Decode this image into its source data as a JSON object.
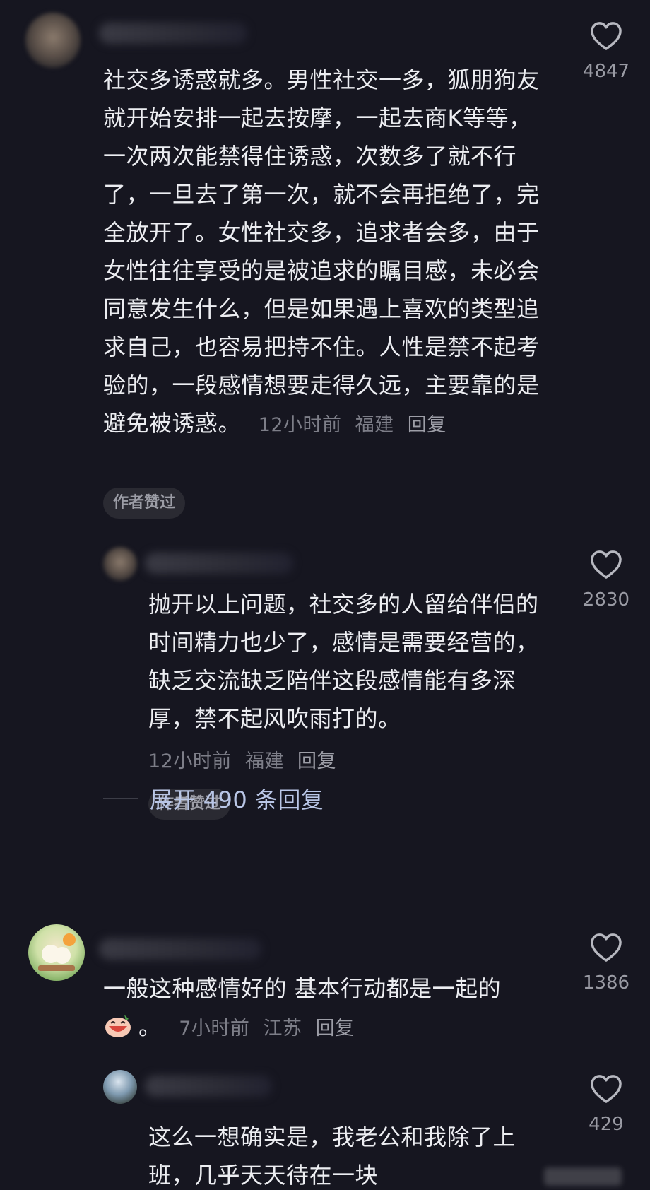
{
  "comments": [
    {
      "text": "社交多诱惑就多。男性社交一多，狐朋狗友就开始安排一起去按摩，一起去商K等等，一次两次能禁得住诱惑，次数多了就不行了，一旦去了第一次，就不会再拒绝了，完全放开了。女性社交多，追求者会多，由于女性往往享受的是被追求的瞩目感，未必会同意发生什么，但是如果遇上喜欢的类型追求自己，也容易把持不住。人性是禁不起考验的，一段感情想要走得久远，主要靠的是避免被诱惑。",
      "time": "12小时前",
      "location": "福建",
      "reply_label": "回复",
      "badge": "作者赞过",
      "likes": "4847"
    },
    {
      "text": "抛开以上问题，社交多的人留给伴侣的时间精力也少了，感情是需要经营的，缺乏交流缺乏陪伴这段感情能有多深厚，禁不起风吹雨打的。",
      "time": "12小时前",
      "location": "福建",
      "reply_label": "回复",
      "badge": "作者赞过",
      "likes": "2830"
    },
    {
      "text": "一般这种感情好的 基本行动都是一起的",
      "text_tail": "。",
      "time": "7小时前",
      "location": "江苏",
      "reply_label": "回复",
      "likes": "1386"
    },
    {
      "text": "这么一想确实是，我老公和我除了上班，几乎天天待在一块",
      "likes": "429"
    }
  ],
  "expand_replies": "展开 490 条回复",
  "icons": {
    "like": "heart-outline-icon",
    "emoji": "laughing-face-emoji-icon"
  },
  "colors": {
    "background": "#161620",
    "text": "#ecedf1",
    "meta": "#7d7e88",
    "link": "#b9c6e6"
  }
}
